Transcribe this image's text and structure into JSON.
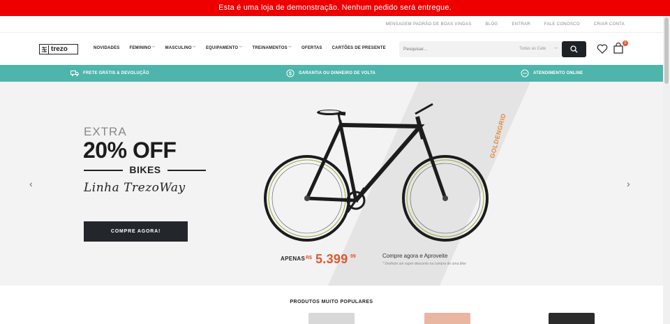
{
  "demo_notice": "Esta é uma loja de demonstração. Nenhum pedido será entregue.",
  "topbar": {
    "welcome": "Mensagem padrão de boas vindas",
    "links": [
      "Blog",
      "Entrar",
      "Fale Conosco",
      "Criar Conta"
    ]
  },
  "header": {
    "logo_text": "trezo",
    "nav": [
      {
        "label": "Novidades",
        "dropdown": false
      },
      {
        "label": "Feminino",
        "dropdown": true
      },
      {
        "label": "Masculino",
        "dropdown": true
      },
      {
        "label": "Equipamento",
        "dropdown": true
      },
      {
        "label": "Treinamentos",
        "dropdown": true
      },
      {
        "label": "Ofertas",
        "dropdown": false
      },
      {
        "label": "Cartões de Presente",
        "dropdown": false
      }
    ],
    "search_placeholder": "Pesquisar...",
    "search_category": "Todas as Cate",
    "cart_count": "0"
  },
  "benefits": [
    {
      "icon": "truck-icon",
      "label": "Frete grátis & devolução"
    },
    {
      "icon": "money-back-icon",
      "label": "Garantia ou dinheiro de volta"
    },
    {
      "icon": "support-icon",
      "label": "Atendimento online"
    }
  ],
  "hero": {
    "eyebrow": "EXTRA",
    "headline": "20% OFF",
    "subhead": "BIKES",
    "tagline": "Linha TrezoWay",
    "cta": "Compre agora!",
    "brand": "GOLDENGRID",
    "price_prefix": "APENAS",
    "currency": "R$",
    "price": "5.399",
    "price_cents": "99",
    "promo_title": "Compre agora e Aproveite",
    "promo_note": "* Desfrute um super desconto na compra de uma bike"
  },
  "section_title": "Produtos muito populares",
  "colors": {
    "demo_bar": "#ee0000",
    "benefits_bar": "#4db5ab",
    "accent_price": "#e2572e",
    "dark_button": "#23272b"
  }
}
